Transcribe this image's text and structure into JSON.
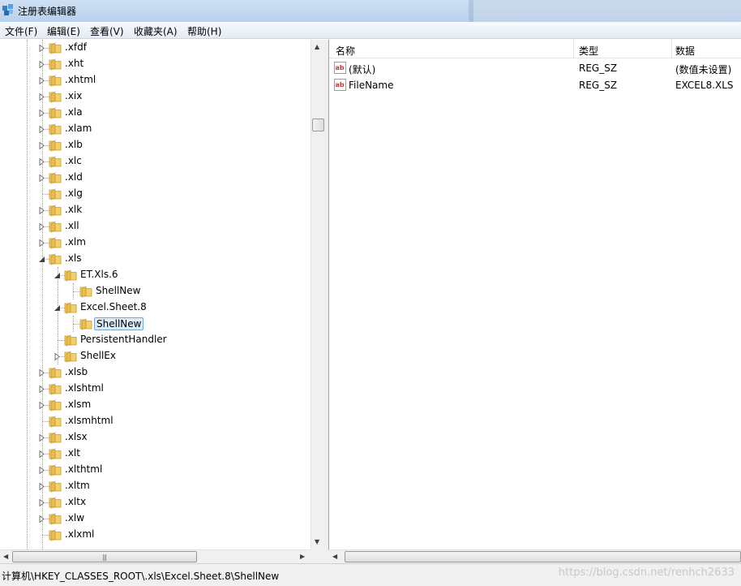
{
  "window": {
    "title": "注册表编辑器"
  },
  "menu": [
    {
      "label": "文件(F)"
    },
    {
      "label": "编辑(E)"
    },
    {
      "label": "查看(V)"
    },
    {
      "label": "收藏夹(A)"
    },
    {
      "label": "帮助(H)"
    }
  ],
  "tree": {
    "nodes": [
      {
        "label": ".xfdf",
        "level": 0,
        "expander": "collapsed"
      },
      {
        "label": ".xht",
        "level": 0,
        "expander": "collapsed"
      },
      {
        "label": ".xhtml",
        "level": 0,
        "expander": "collapsed"
      },
      {
        "label": ".xix",
        "level": 0,
        "expander": "collapsed"
      },
      {
        "label": ".xla",
        "level": 0,
        "expander": "collapsed"
      },
      {
        "label": ".xlam",
        "level": 0,
        "expander": "collapsed"
      },
      {
        "label": ".xlb",
        "level": 0,
        "expander": "collapsed"
      },
      {
        "label": ".xlc",
        "level": 0,
        "expander": "collapsed"
      },
      {
        "label": ".xld",
        "level": 0,
        "expander": "collapsed"
      },
      {
        "label": ".xlg",
        "level": 0,
        "expander": "none"
      },
      {
        "label": ".xlk",
        "level": 0,
        "expander": "collapsed"
      },
      {
        "label": ".xll",
        "level": 0,
        "expander": "collapsed"
      },
      {
        "label": ".xlm",
        "level": 0,
        "expander": "collapsed"
      },
      {
        "label": ".xls",
        "level": 0,
        "expander": "expanded"
      },
      {
        "label": "ET.Xls.6",
        "level": 1,
        "expander": "expanded"
      },
      {
        "label": "ShellNew",
        "level": 2,
        "expander": "none"
      },
      {
        "label": "Excel.Sheet.8",
        "level": 1,
        "expander": "expanded"
      },
      {
        "label": "ShellNew",
        "level": 2,
        "expander": "none",
        "selected": true
      },
      {
        "label": "PersistentHandler",
        "level": 1,
        "expander": "none"
      },
      {
        "label": "ShellEx",
        "level": 1,
        "expander": "collapsed"
      },
      {
        "label": ".xlsb",
        "level": 0,
        "expander": "collapsed"
      },
      {
        "label": ".xlshtml",
        "level": 0,
        "expander": "collapsed"
      },
      {
        "label": ".xlsm",
        "level": 0,
        "expander": "collapsed"
      },
      {
        "label": ".xlsmhtml",
        "level": 0,
        "expander": "none"
      },
      {
        "label": ".xlsx",
        "level": 0,
        "expander": "collapsed"
      },
      {
        "label": ".xlt",
        "level": 0,
        "expander": "collapsed"
      },
      {
        "label": ".xlthtml",
        "level": 0,
        "expander": "collapsed"
      },
      {
        "label": ".xltm",
        "level": 0,
        "expander": "collapsed"
      },
      {
        "label": ".xltx",
        "level": 0,
        "expander": "collapsed"
      },
      {
        "label": ".xlw",
        "level": 0,
        "expander": "collapsed"
      },
      {
        "label": ".xlxml",
        "level": 0,
        "expander": "none"
      }
    ]
  },
  "values": {
    "columns": [
      "名称",
      "类型",
      "数据"
    ],
    "rows": [
      {
        "name": "(默认)",
        "type": "REG_SZ",
        "data": "(数值未设置)"
      },
      {
        "name": "FileName",
        "type": "REG_SZ",
        "data": "EXCEL8.XLS"
      }
    ]
  },
  "status": {
    "path": "计算机\\HKEY_CLASSES_ROOT\\.xls\\Excel.Sheet.8\\ShellNew",
    "watermark": "https://blog.csdn.net/renhch2633"
  },
  "colors": {
    "selection_bg": "#dcebfc",
    "selection_border": "#7da2ce",
    "folder": "#e8c15a",
    "icon_ab": "#c0392b"
  },
  "icons": {
    "app": "registry-editor-icon",
    "folder": "folder-icon",
    "value": "string-value-icon"
  }
}
